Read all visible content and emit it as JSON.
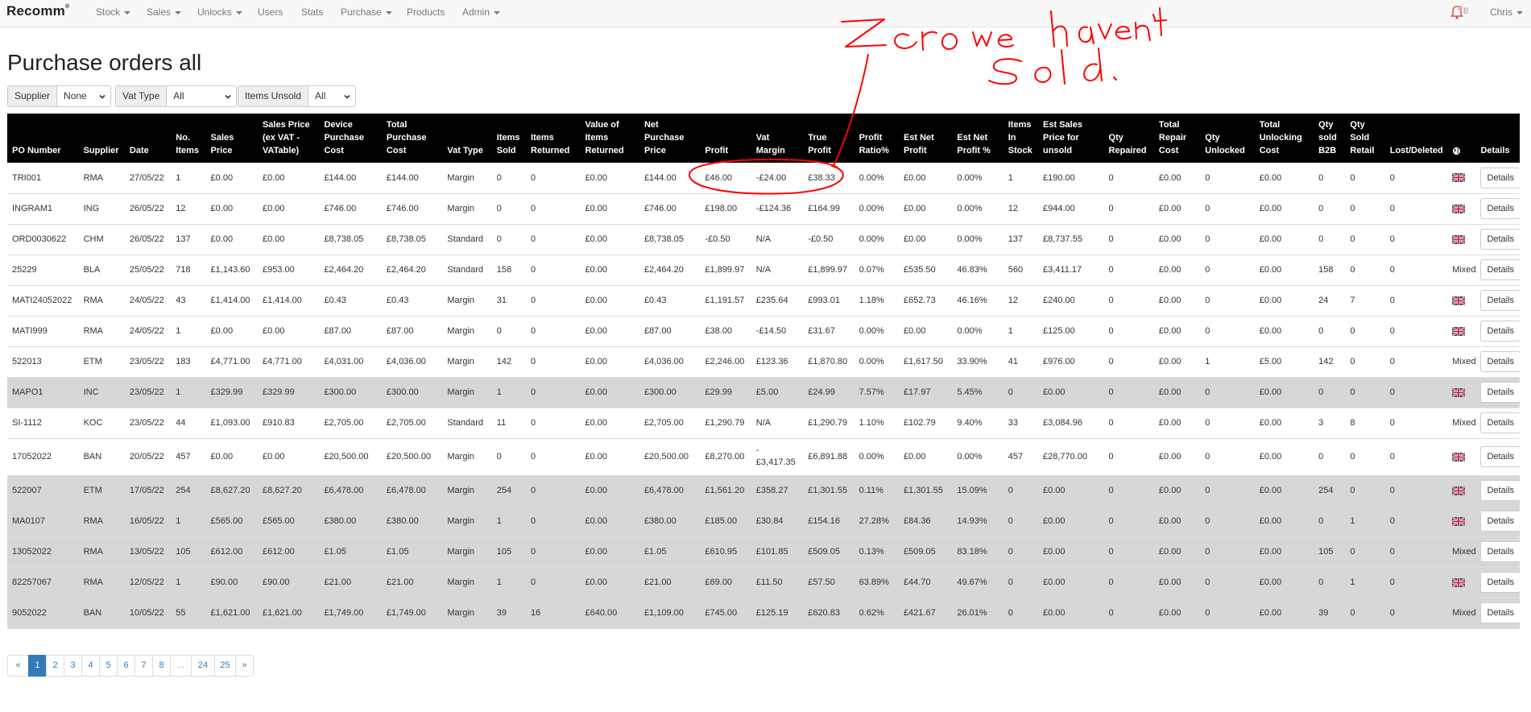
{
  "navbar": {
    "brand": "Recomm",
    "brand_mark": "®",
    "items": [
      {
        "label": "Stock",
        "dropdown": true
      },
      {
        "label": "Sales",
        "dropdown": true
      },
      {
        "label": "Unlocks",
        "dropdown": true
      },
      {
        "label": "Users",
        "dropdown": false
      },
      {
        "label": "Stats",
        "dropdown": false
      },
      {
        "label": "Purchase",
        "dropdown": true
      },
      {
        "label": "Products",
        "dropdown": false
      },
      {
        "label": "Admin",
        "dropdown": true
      }
    ],
    "notification_count": "8",
    "user": "Chris"
  },
  "page": {
    "title": "Purchase orders all"
  },
  "filters": [
    {
      "label": "Supplier",
      "value": "None"
    },
    {
      "label": "Vat Type",
      "value": "All"
    },
    {
      "label": "Items Unsold",
      "value": "All"
    }
  ],
  "table": {
    "headers": [
      "PO Number",
      "Supplier",
      "Date",
      "No. Items",
      "Sales Price",
      "Sales Price (ex VAT - VATable)",
      "Device Purchase Cost",
      "Total Purchase Cost",
      "Vat Type",
      "Items Sold",
      "Items Returned",
      "Value of Items Returned",
      "Net Purchase Price",
      "Profit",
      "Vat Margin",
      "True Profit",
      "Profit Ratio%",
      "Est Net Profit",
      "Est Net Profit %",
      "Items In Stock",
      "Est Sales Price for unsold",
      "Qty Repaired",
      "Total Repair Cost",
      "Qty Unlocked",
      "Total Unlocking Cost",
      "Qty sold B2B",
      "Qty Sold Retail",
      "Lost/Deleted",
      "globe-icon",
      "Details"
    ],
    "details_label": "Details",
    "mixed_label": "Mixed",
    "rows": [
      {
        "cells": [
          "TRI001",
          "RMA",
          "27/05/22",
          "1",
          "£0.00",
          "£0.00",
          "£144.00",
          "£144.00",
          "Margin",
          "0",
          "0",
          "£0.00",
          "£144.00",
          "£46.00",
          "-£24.00",
          "£38.33",
          "0.00%",
          "£0.00",
          "0.00%",
          "1",
          "£190.00",
          "0",
          "£0.00",
          "0",
          "£0.00",
          "0",
          "0",
          "0"
        ],
        "flag": "uk-flag"
      },
      {
        "cells": [
          "INGRAM1",
          "ING",
          "26/05/22",
          "12",
          "£0.00",
          "£0.00",
          "£746.00",
          "£746.00",
          "Margin",
          "0",
          "0",
          "£0.00",
          "£746.00",
          "£198.00",
          "-£124.36",
          "£164.99",
          "0.00%",
          "£0.00",
          "0.00%",
          "12",
          "£944.00",
          "0",
          "£0.00",
          "0",
          "£0.00",
          "0",
          "0",
          "0"
        ],
        "flag": "uk-flag"
      },
      {
        "cells": [
          "ORD0030622",
          "CHM",
          "26/05/22",
          "137",
          "£0.00",
          "£0.00",
          "£8,738.05",
          "£8,738.05",
          "Standard",
          "0",
          "0",
          "£0.00",
          "£8,738.05",
          "-£0.50",
          "N/A",
          "-£0.50",
          "0.00%",
          "£0.00",
          "0.00%",
          "137",
          "£8,737.55",
          "0",
          "£0.00",
          "0",
          "£0.00",
          "0",
          "0",
          "0"
        ],
        "flag": "uk-flag"
      },
      {
        "cells": [
          "25229",
          "BLA",
          "25/05/22",
          "718",
          "£1,143.60",
          "£953.00",
          "£2,464.20",
          "£2,464.20",
          "Standard",
          "158",
          "0",
          "£0.00",
          "£2,464.20",
          "£1,899.97",
          "N/A",
          "£1,899.97",
          "0.07%",
          "£535.50",
          "46.83%",
          "560",
          "£3,411.17",
          "0",
          "£0.00",
          "0",
          "£0.00",
          "158",
          "0",
          "0"
        ],
        "flag": "mixed"
      },
      {
        "cells": [
          "MATI24052022",
          "RMA",
          "24/05/22",
          "43",
          "£1,414.00",
          "£1,414.00",
          "£0.43",
          "£0.43",
          "Margin",
          "31",
          "0",
          "£0.00",
          "£0.43",
          "£1,191.57",
          "£235.64",
          "£993.01",
          "1.18%",
          "£652.73",
          "46.16%",
          "12",
          "£240.00",
          "0",
          "£0.00",
          "0",
          "£0.00",
          "24",
          "7",
          "0"
        ],
        "flag": "uk-flag"
      },
      {
        "cells": [
          "MATI999",
          "RMA",
          "24/05/22",
          "1",
          "£0.00",
          "£0.00",
          "£87.00",
          "£87.00",
          "Margin",
          "0",
          "0",
          "£0.00",
          "£87.00",
          "£38.00",
          "-£14.50",
          "£31.67",
          "0.00%",
          "£0.00",
          "0.00%",
          "1",
          "£125.00",
          "0",
          "£0.00",
          "0",
          "£0.00",
          "0",
          "0",
          "0"
        ],
        "flag": "uk-flag"
      },
      {
        "cells": [
          "522013",
          "ETM",
          "23/05/22",
          "183",
          "£4,771.00",
          "£4,771.00",
          "£4,031.00",
          "£4,036.00",
          "Margin",
          "142",
          "0",
          "£0.00",
          "£4,036.00",
          "£2,246.00",
          "£123.36",
          "£1,870.80",
          "0.00%",
          "£1,617.50",
          "33.90%",
          "41",
          "£976.00",
          "0",
          "£0.00",
          "1",
          "£5.00",
          "142",
          "0",
          "0"
        ],
        "flag": "mixed"
      },
      {
        "cells": [
          "MAPO1",
          "INC",
          "23/05/22",
          "1",
          "£329.99",
          "£329.99",
          "£300.00",
          "£300.00",
          "Margin",
          "1",
          "0",
          "£0.00",
          "£300.00",
          "£29.99",
          "£5.00",
          "£24.99",
          "7.57%",
          "£17.97",
          "5.45%",
          "0",
          "£0.00",
          "0",
          "£0.00",
          "0",
          "£0.00",
          "0",
          "0",
          "0"
        ],
        "flag": "uk-flag",
        "grey": true
      },
      {
        "cells": [
          "SI-1112",
          "KOC",
          "23/05/22",
          "44",
          "£1,093.00",
          "£910.83",
          "£2,705.00",
          "£2,705.00",
          "Standard",
          "11",
          "0",
          "£0.00",
          "£2,705.00",
          "£1,290.79",
          "N/A",
          "£1,290.79",
          "1.10%",
          "£102.79",
          "9.40%",
          "33",
          "£3,084.96",
          "0",
          "£0.00",
          "0",
          "£0.00",
          "3",
          "8",
          "0"
        ],
        "flag": "mixed"
      },
      {
        "cells": [
          "17052022",
          "BAN",
          "20/05/22",
          "457",
          "£0.00",
          "£0.00",
          "£20,500.00",
          "£20,500.00",
          "Margin",
          "0",
          "0",
          "£0.00",
          "£20,500.00",
          "£8,270.00",
          "- £3,417.35",
          "£6,891.88",
          "0.00%",
          "£0.00",
          "0.00%",
          "457",
          "£28,770.00",
          "0",
          "£0.00",
          "0",
          "£0.00",
          "0",
          "0",
          "0"
        ],
        "flag": "uk-flag",
        "tall": true
      },
      {
        "cells": [
          "522007",
          "ETM",
          "17/05/22",
          "254",
          "£8,627.20",
          "£8,627.20",
          "£6,478.00",
          "£6,478.00",
          "Margin",
          "254",
          "0",
          "£0.00",
          "£6,478.00",
          "£1,561.20",
          "£358.27",
          "£1,301.55",
          "0.11%",
          "£1,301.55",
          "15.09%",
          "0",
          "£0.00",
          "0",
          "£0.00",
          "0",
          "£0.00",
          "254",
          "0",
          "0"
        ],
        "flag": "uk-flag",
        "grey": true
      },
      {
        "cells": [
          "MA0107",
          "RMA",
          "16/05/22",
          "1",
          "£565.00",
          "£565.00",
          "£380.00",
          "£380.00",
          "Margin",
          "1",
          "0",
          "£0.00",
          "£380.00",
          "£185.00",
          "£30.84",
          "£154.16",
          "27.28%",
          "£84.36",
          "14.93%",
          "0",
          "£0.00",
          "0",
          "£0.00",
          "0",
          "£0.00",
          "0",
          "1",
          "0"
        ],
        "flag": "uk-flag",
        "grey": true
      },
      {
        "cells": [
          "13052022",
          "RMA",
          "13/05/22",
          "105",
          "£612.00",
          "£612.00",
          "£1.05",
          "£1.05",
          "Margin",
          "105",
          "0",
          "£0.00",
          "£1.05",
          "£610.95",
          "£101.85",
          "£509.05",
          "0.13%",
          "£509.05",
          "83.18%",
          "0",
          "£0.00",
          "0",
          "£0.00",
          "0",
          "£0.00",
          "105",
          "0",
          "0"
        ],
        "flag": "mixed",
        "grey": true
      },
      {
        "cells": [
          "82257067",
          "RMA",
          "12/05/22",
          "1",
          "£90.00",
          "£90.00",
          "£21.00",
          "£21.00",
          "Margin",
          "1",
          "0",
          "£0.00",
          "£21.00",
          "£69.00",
          "£11.50",
          "£57.50",
          "63.89%",
          "£44.70",
          "49.67%",
          "0",
          "£0.00",
          "0",
          "£0.00",
          "0",
          "£0.00",
          "0",
          "1",
          "0"
        ],
        "flag": "uk-flag",
        "grey": true
      },
      {
        "cells": [
          "9052022",
          "BAN",
          "10/05/22",
          "55",
          "£1,621.00",
          "£1,621.00",
          "£1,749.00",
          "£1,749.00",
          "Margin",
          "39",
          "16",
          "£640.00",
          "£1,109.00",
          "£745.00",
          "£125.19",
          "£620.83",
          "0.62%",
          "£421.67",
          "26.01%",
          "0",
          "£0.00",
          "0",
          "£0.00",
          "0",
          "£0.00",
          "39",
          "0",
          "0"
        ],
        "flag": "mixed",
        "grey": true
      }
    ]
  },
  "pagination": {
    "items": [
      "«",
      "1",
      "2",
      "3",
      "4",
      "5",
      "6",
      "7",
      "8",
      "...",
      "24",
      "25",
      "»"
    ],
    "active": "1"
  },
  "annotation": {
    "text_zero": "Zero",
    "text_line2": "we haven't",
    "text_line3": "Sold",
    "color": "#ff0000"
  },
  "colors": {
    "header_bg": "#000000",
    "grey_row": "#d7d7d7",
    "link": "#337ab7",
    "annotation": "#ff0000"
  }
}
